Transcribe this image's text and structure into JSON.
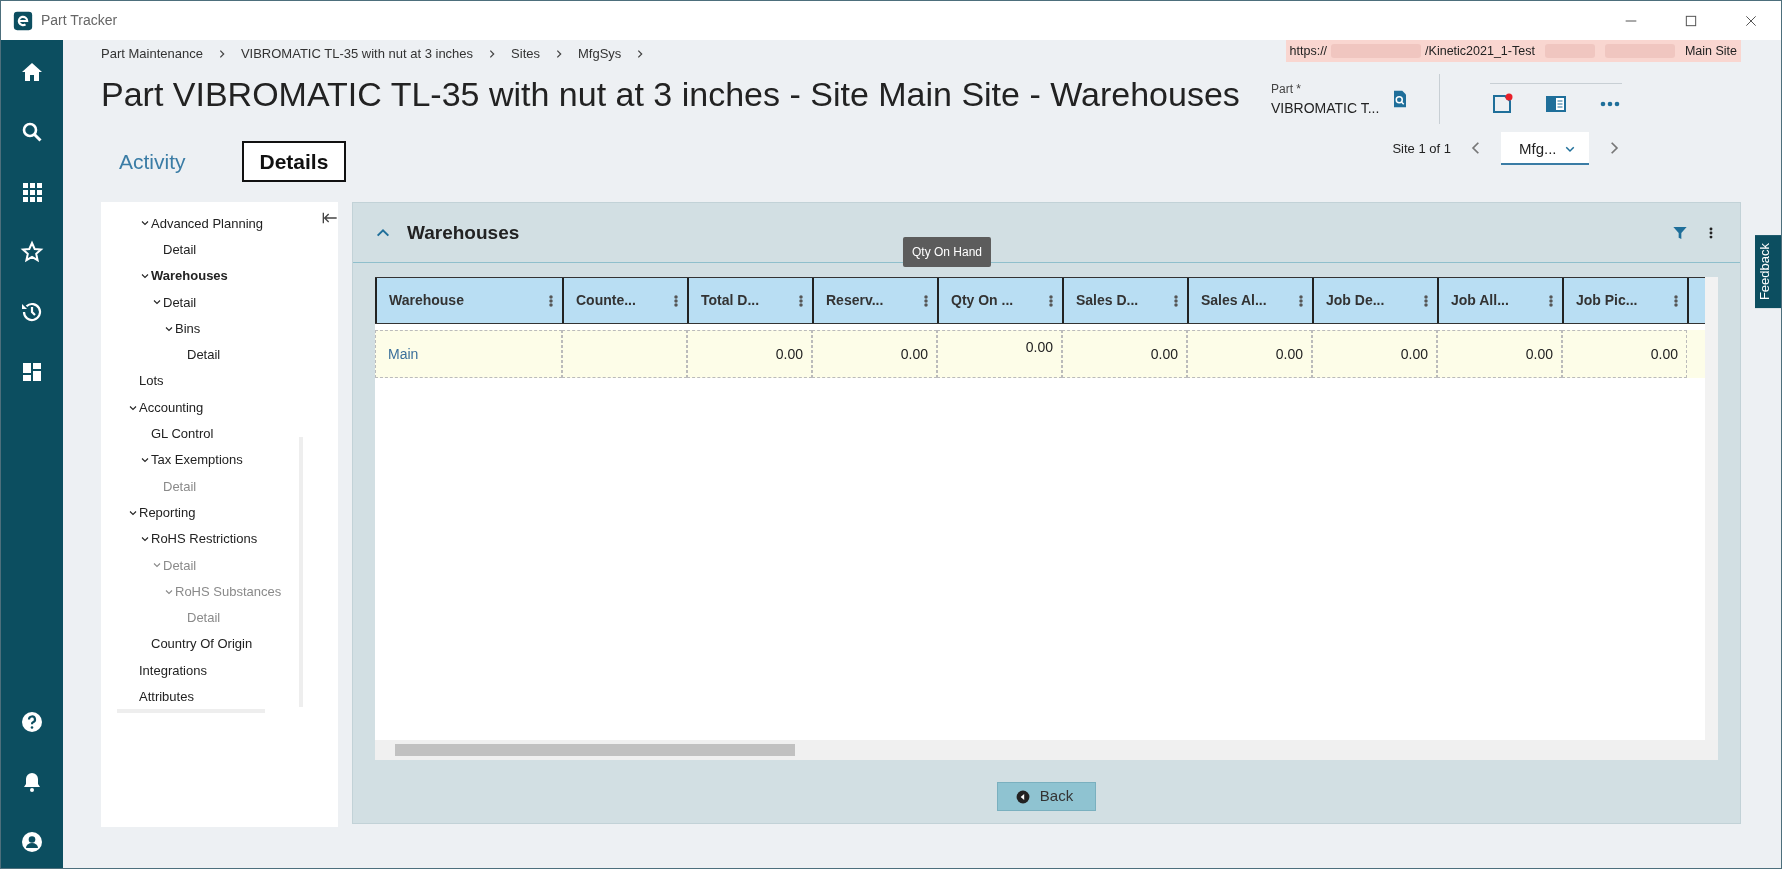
{
  "window": {
    "title": "Part Tracker"
  },
  "breadcrumb": [
    "Part Maintenance",
    "VIBROMATIC TL-35 with nut at 3 inches",
    "Sites",
    "MfgSys"
  ],
  "environment": {
    "url_start": "https://",
    "url_end": "/Kinetic2021_1-Test",
    "site": "Main Site"
  },
  "page_title": "Part VIBROMATIC TL-35 with nut at 3 inches - Site Main Site - Warehouses",
  "part_field": {
    "label": "Part *",
    "value": "VIBROMATIC T..."
  },
  "tabs": [
    {
      "label": "Activity",
      "selected": false
    },
    {
      "label": "Details",
      "selected": true
    }
  ],
  "site_pager": {
    "text": "Site 1 of 1",
    "value": "Mfg..."
  },
  "tree": [
    {
      "children": [
        {
          "label": "Advanced Planning",
          "expanded": true,
          "selected": false,
          "disabled": false,
          "children": [
            {
              "label": "Detail",
              "selected": false,
              "disabled": false
            }
          ]
        },
        {
          "label": "Warehouses",
          "expanded": true,
          "selected": true,
          "disabled": false,
          "children": [
            {
              "label": "Detail",
              "expanded": true,
              "selected": false,
              "disabled": false,
              "children": [
                {
                  "label": "Bins",
                  "expanded": true,
                  "selected": false,
                  "disabled": false,
                  "children": [
                    {
                      "label": "Detail",
                      "selected": false,
                      "disabled": false
                    }
                  ]
                }
              ]
            }
          ]
        }
      ]
    },
    {
      "label": "Lots",
      "selected": false,
      "disabled": false
    },
    {
      "label": "Accounting",
      "expanded": true,
      "selected": false,
      "disabled": false,
      "children": [
        {
          "label": "GL Control",
          "selected": false,
          "disabled": false
        },
        {
          "label": "Tax Exemptions",
          "expanded": true,
          "selected": false,
          "disabled": false,
          "children": [
            {
              "label": "Detail",
              "selected": false,
              "disabled": true
            }
          ]
        }
      ]
    },
    {
      "label": "Reporting",
      "expanded": true,
      "selected": false,
      "disabled": false,
      "children": [
        {
          "label": "RoHS Restrictions",
          "expanded": true,
          "selected": false,
          "disabled": false,
          "children": [
            {
              "label": "Detail",
              "expanded": true,
              "selected": false,
              "disabled": true,
              "children": [
                {
                  "label": "RoHS Substances",
                  "expanded": true,
                  "selected": false,
                  "disabled": true,
                  "children": [
                    {
                      "label": "Detail",
                      "selected": false,
                      "disabled": true
                    }
                  ]
                }
              ]
            }
          ]
        },
        {
          "label": "Country Of Origin",
          "selected": false,
          "disabled": false
        }
      ]
    },
    {
      "label": "Integrations",
      "selected": false,
      "disabled": false
    },
    {
      "label": "Attributes",
      "selected": false,
      "disabled": false
    }
  ],
  "panel": {
    "title": "Warehouses",
    "expanded": true
  },
  "grid": {
    "columns": [
      {
        "label": "Warehouse"
      },
      {
        "label": "Counte..."
      },
      {
        "label": "Total D..."
      },
      {
        "label": "Reserv..."
      },
      {
        "label": "Qty On ...",
        "tooltip": "Qty On Hand"
      },
      {
        "label": "Sales D..."
      },
      {
        "label": "Sales Al..."
      },
      {
        "label": "Job De..."
      },
      {
        "label": "Job All..."
      },
      {
        "label": "Job Pic..."
      }
    ],
    "rows": [
      {
        "cells": [
          "Main",
          null,
          "0.00",
          "0.00",
          "0.00",
          "0.00",
          "0.00",
          "0.00",
          "0.00",
          "0.00"
        ]
      }
    ]
  },
  "back_button": "Back",
  "feedback": "Feedback"
}
